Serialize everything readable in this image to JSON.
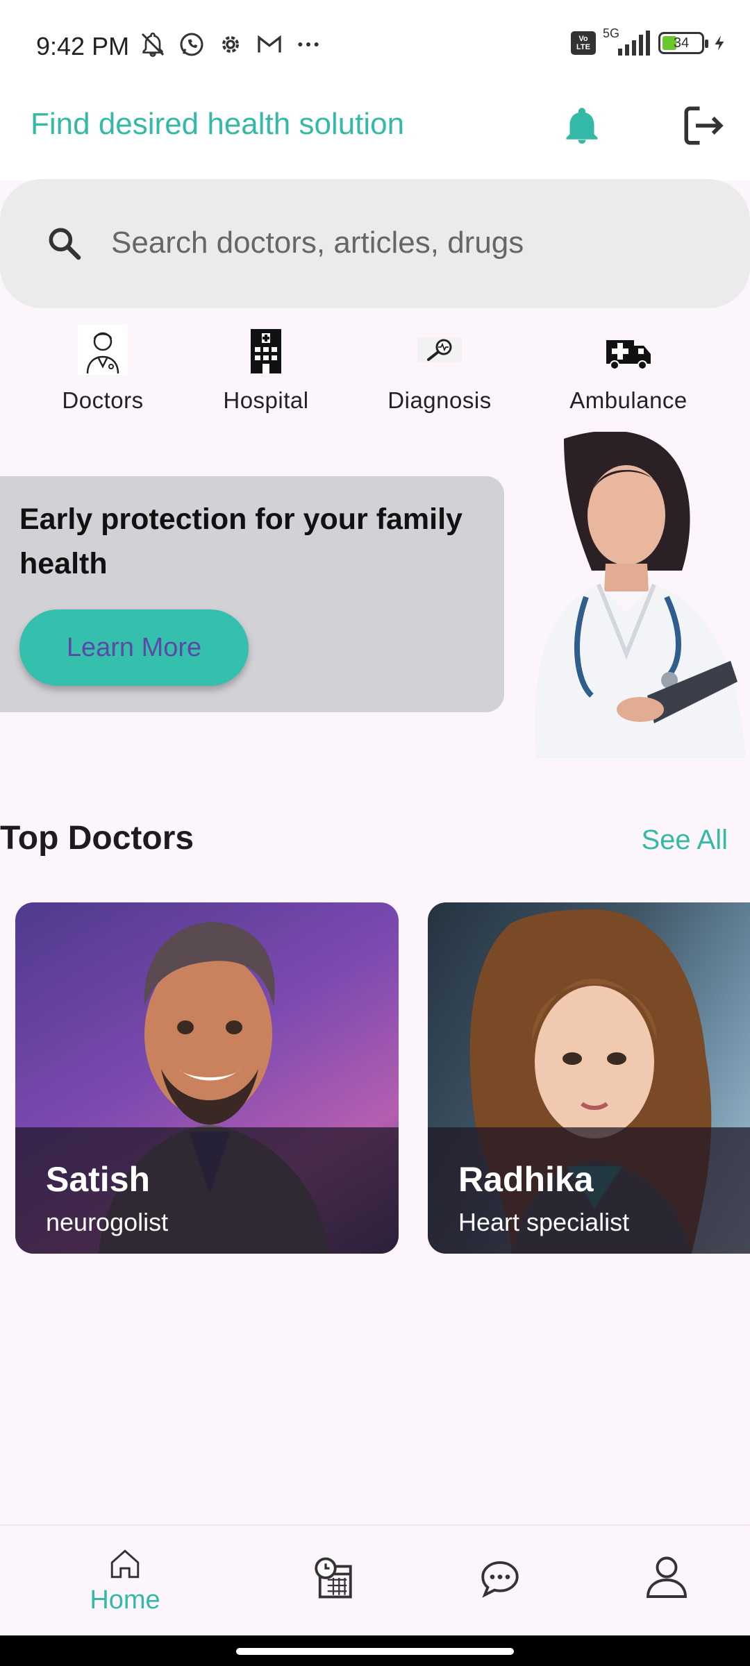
{
  "status_bar": {
    "time": "9:42 PM",
    "network": "5G",
    "volte": "Vo LTE",
    "battery": "34",
    "icons": [
      "mute-icon",
      "whatsapp-icon",
      "settings-gear-icon",
      "gmail-icon",
      "more-dots-icon"
    ]
  },
  "header": {
    "title": "Find desired health solution",
    "accent_color": "#35b9a7"
  },
  "search": {
    "placeholder": "Search doctors, articles, drugs"
  },
  "categories": [
    {
      "label": "Doctors",
      "icon": "doctor-icon"
    },
    {
      "label": "Hospital",
      "icon": "hospital-icon"
    },
    {
      "label": "Diagnosis",
      "icon": "diagnosis-icon"
    },
    {
      "label": "Ambulance",
      "icon": "ambulance-icon"
    }
  ],
  "promo": {
    "text": "Early protection for your family health",
    "button_label": "Learn More"
  },
  "top_doctors": {
    "title": "Top Doctors",
    "see_all": "See All",
    "doctors": [
      {
        "name": "Satish",
        "specialty": "neurogolist"
      },
      {
        "name": "Radhika",
        "specialty": "Heart specialist"
      }
    ]
  },
  "bottom_nav": {
    "items": [
      {
        "label": "Home",
        "icon": "home-icon",
        "active": true
      },
      {
        "label": "",
        "icon": "appointments-calendar-icon"
      },
      {
        "label": "",
        "icon": "chat-icon"
      },
      {
        "label": "",
        "icon": "profile-icon"
      }
    ]
  }
}
